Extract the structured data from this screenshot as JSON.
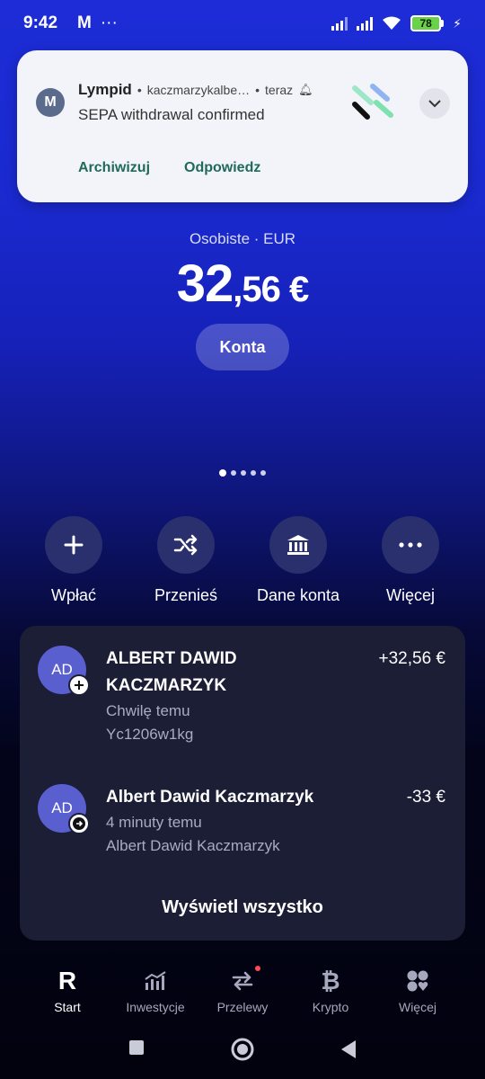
{
  "status_bar": {
    "time": "9:42",
    "battery": "78"
  },
  "notification": {
    "app_name": "Lympid",
    "sender": "kaczmarzykalbe…",
    "time": "teraz",
    "message": "SEPA withdrawal confirmed",
    "actions": [
      "Archiwizuj",
      "Odpowiedz"
    ]
  },
  "account": {
    "label": "Osobiste · EUR",
    "balance_int": "32",
    "balance_dec": ",56 €",
    "accounts_button": "Konta"
  },
  "quick_actions": [
    {
      "label": "Wpłać",
      "icon": "plus-icon"
    },
    {
      "label": "Przenieś",
      "icon": "shuffle-icon"
    },
    {
      "label": "Dane konta",
      "icon": "bank-icon"
    },
    {
      "label": "Więcej",
      "icon": "more-icon"
    }
  ],
  "transactions": [
    {
      "initials": "AD",
      "name_line1": "ALBERT DAWID",
      "name_line2": "KACZMARZYK",
      "time": "Chwilę temu",
      "reference": "Yc1206w1kg",
      "amount": "+32,56 €",
      "badge": "plus-badge-icon"
    },
    {
      "initials": "AD",
      "name": "Albert Dawid Kaczmarzyk",
      "time": "4 minuty temu",
      "reference": "Albert Dawid Kaczmarzyk",
      "amount": "-33 €",
      "badge": "arrow-right-badge-icon"
    }
  ],
  "view_all": "Wyświetl wszystko",
  "bottom_nav": [
    {
      "label": "Start",
      "icon": "revolut-logo-icon",
      "active": true
    },
    {
      "label": "Inwestycje",
      "icon": "chart-icon"
    },
    {
      "label": "Przelewy",
      "icon": "transfer-icon"
    },
    {
      "label": "Krypto",
      "icon": "bitcoin-icon"
    },
    {
      "label": "Więcej",
      "icon": "grid-icon"
    }
  ]
}
